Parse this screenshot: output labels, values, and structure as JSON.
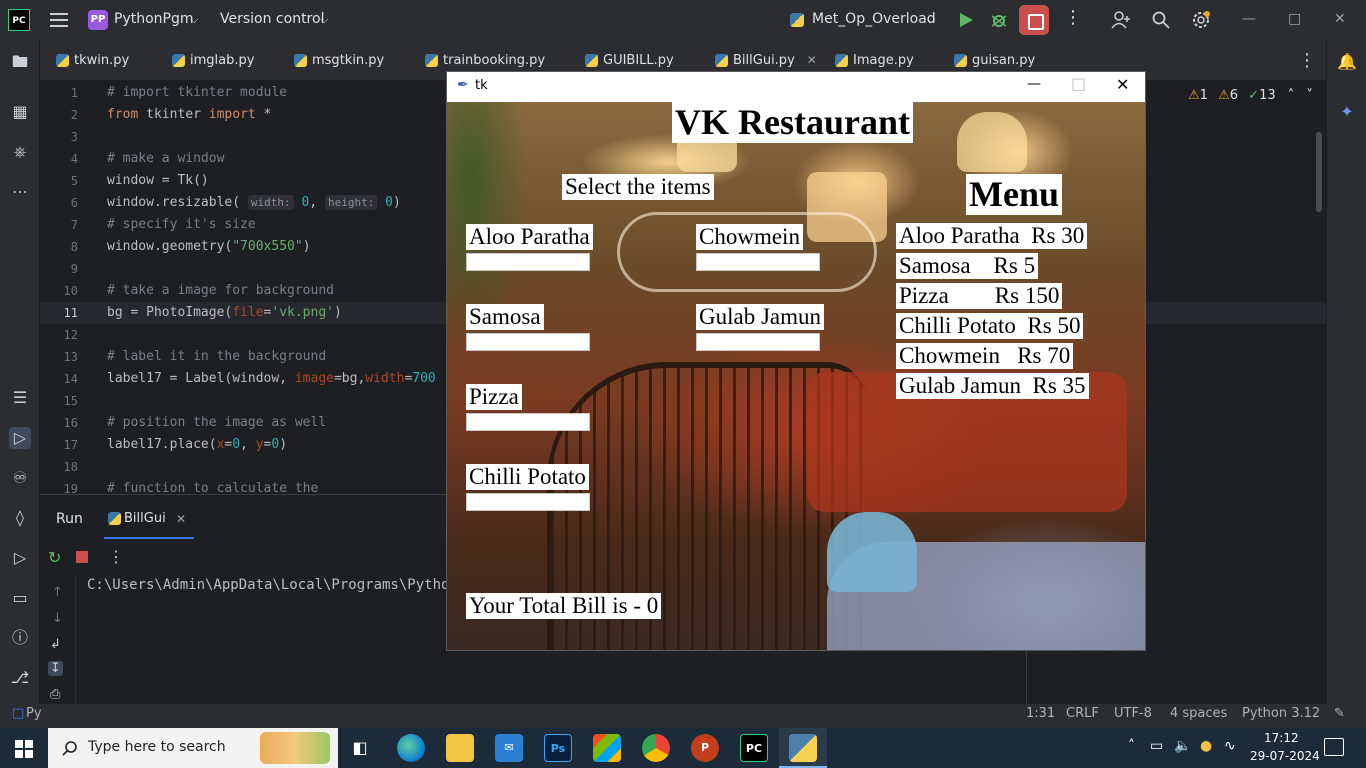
{
  "ide": {
    "logo": "PC",
    "project_badge": "PP",
    "project": "PythonPgm",
    "vcs": "Version control",
    "run_config": "Met_Op_Overload"
  },
  "tabs": [
    {
      "label": "tkwin.py"
    },
    {
      "label": "imglab.py"
    },
    {
      "label": "msgtkin.py"
    },
    {
      "label": "trainbooking.py"
    },
    {
      "label": "GUIBILL.py"
    },
    {
      "label": "BillGui.py",
      "active": true
    },
    {
      "label": "Image.py"
    },
    {
      "label": "guisan.py"
    }
  ],
  "inspections": {
    "warnings": "1",
    "weak": "6",
    "typos": "13"
  },
  "editor": {
    "line_numbers": [
      "1",
      "2",
      "3",
      "4",
      "5",
      "6",
      "7",
      "8",
      "9",
      "10",
      "11",
      "12",
      "13",
      "14",
      "15",
      "16",
      "17",
      "18",
      "19"
    ],
    "hints": {
      "width": "width:",
      "height": "height:"
    }
  },
  "run": {
    "tab_run": "Run",
    "tab_bill": "BillGui",
    "output": "C:\\Users\\Admin\\AppData\\Local\\Programs\\Python\\"
  },
  "status": {
    "project_short": "Py",
    "position": "1:31",
    "line_sep": "CRLF",
    "encoding": "UTF-8",
    "indent": "4 spaces",
    "interpreter": "Python 3.12"
  },
  "taskbar": {
    "search_placeholder": "Type here to search",
    "time": "17:12",
    "date": "29-07-2024"
  },
  "tk": {
    "window_title": "tk",
    "heading": "VK Restaurant",
    "select_label": "Select the items",
    "menu_title": "Menu",
    "items": [
      "Aloo Paratha",
      "Chowmein",
      "Samosa",
      "Gulab Jamun",
      "Pizza",
      "Chilli Potato"
    ],
    "menu_lines": [
      "Aloo Paratha  Rs 30",
      "Samosa    Rs 5",
      "Pizza        Rs 150",
      "Chilli Potato  Rs 50",
      "Chowmein   Rs 70",
      "Gulab Jamun  Rs 35"
    ],
    "total": "Your Total Bill is - 0"
  }
}
